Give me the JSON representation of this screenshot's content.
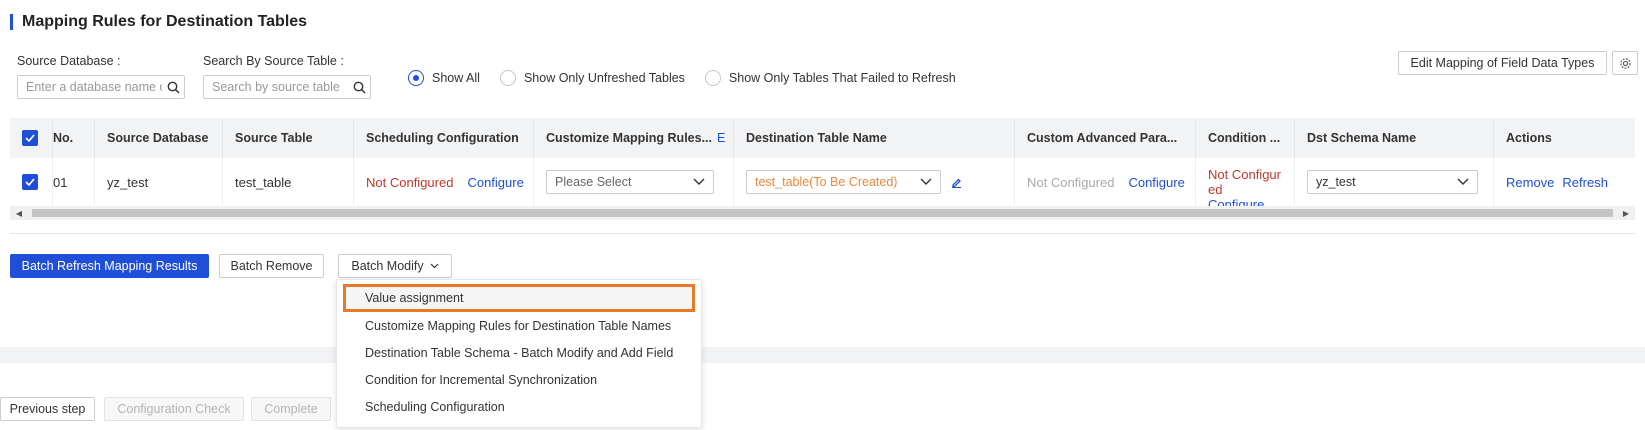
{
  "section": {
    "title": "Mapping Rules for Destination Tables"
  },
  "filters": {
    "source_db_label": "Source Database :",
    "source_db_placeholder": "Enter a database name or",
    "source_table_label": "Search By Source Table :",
    "source_table_placeholder": "Search by source table",
    "radio_options": [
      {
        "label": "Show All",
        "selected": true
      },
      {
        "label": "Show Only Unfreshed Tables",
        "selected": false
      },
      {
        "label": "Show Only Tables That Failed to Refresh",
        "selected": false
      }
    ],
    "edit_mapping_label": "Edit Mapping of Field Data Types"
  },
  "table": {
    "headers": {
      "no": "No.",
      "source_db": "Source Database",
      "source_table": "Source Table",
      "scheduling": "Scheduling Configuration",
      "customize": "Customize Mapping Rules...",
      "customize_suffix": "E",
      "dest_table": "Destination Table Name",
      "custom_adv": "Custom Advanced Para...",
      "condition": "Condition ...",
      "dst_schema": "Dst Schema Name",
      "actions": "Actions"
    },
    "rows": [
      {
        "no": "01",
        "source_db": "yz_test",
        "source_table": "test_table",
        "scheduling_status": "Not Configured",
        "scheduling_action": "Configure",
        "customize_value": "Please Select",
        "dest_table_value": "test_table(To Be Created)",
        "custom_adv_status": "Not Configured",
        "custom_adv_action": "Configure",
        "condition_line1": "Not Configur",
        "condition_line2": "ed",
        "condition_action": "Configure",
        "dst_schema_value": "yz_test",
        "action_remove": "Remove",
        "action_refresh": "Refresh"
      }
    ]
  },
  "batch": {
    "refresh_label": "Batch Refresh Mapping Results",
    "remove_label": "Batch Remove",
    "modify_label": "Batch Modify"
  },
  "dropdown": {
    "items": [
      "Value assignment",
      "Customize Mapping Rules for Destination Table Names",
      "Destination Table Schema - Batch Modify and Add Field",
      "Condition for Incremental Synchronization",
      "Scheduling Configuration"
    ]
  },
  "footer": {
    "previous_label": "Previous step",
    "check_label": "Configuration Check",
    "complete_label": "Complete"
  },
  "colors": {
    "accent": "#1f4fd8",
    "error": "#c0392b",
    "warning": "#e8883a",
    "highlight_border": "#e8782a"
  }
}
